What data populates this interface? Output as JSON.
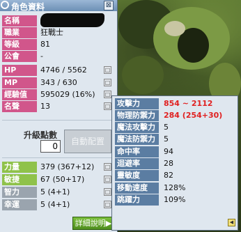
{
  "window": {
    "title": "角色資料",
    "close": "⊠"
  },
  "info_rows": [
    {
      "label": "名稱",
      "value": ""
    },
    {
      "label": "職業",
      "value": "狂戰士"
    },
    {
      "label": "等級",
      "value": "81"
    },
    {
      "label": "公會",
      "value": "-"
    },
    {
      "label": "HP",
      "value": "4746 / 5562"
    },
    {
      "label": "MP",
      "value": "343 / 630"
    },
    {
      "label": "經驗值",
      "value": "595029 (16%)"
    },
    {
      "label": "名聲",
      "value": "13"
    }
  ],
  "ap": {
    "label": "升級點數",
    "value": "0",
    "auto_button": "自動配置"
  },
  "stats": [
    {
      "label": "力量",
      "value": "379 (367+12)"
    },
    {
      "label": "敏捷",
      "value": "67 (50+17)"
    },
    {
      "label": "智力",
      "value": "5 (4+1)"
    },
    {
      "label": "幸運",
      "value": "5 (4+1)"
    }
  ],
  "detail_button": "詳細說明▶",
  "detail": [
    {
      "label": "攻擊力",
      "value": "854 ~ 2112",
      "highlight": true
    },
    {
      "label": "物理防禦力",
      "value": "284 (254+30)",
      "highlight": true
    },
    {
      "label": "魔法攻擊力",
      "value": "5",
      "highlight": false
    },
    {
      "label": "魔法防禦力",
      "value": "5",
      "highlight": false
    },
    {
      "label": "命中率",
      "value": "94",
      "highlight": false
    },
    {
      "label": "迴避率",
      "value": "28",
      "highlight": false
    },
    {
      "label": "靈敏度",
      "value": "82",
      "highlight": false
    },
    {
      "label": "移動速度",
      "value": "128%",
      "highlight": false
    },
    {
      "label": "跳躍力",
      "value": "109%",
      "highlight": false
    }
  ],
  "colors": {
    "pink": "#d1568b",
    "gray": "#9aa4ae",
    "green": "#8fc24a",
    "blue": "#5b7da2",
    "red": "#e02020"
  }
}
